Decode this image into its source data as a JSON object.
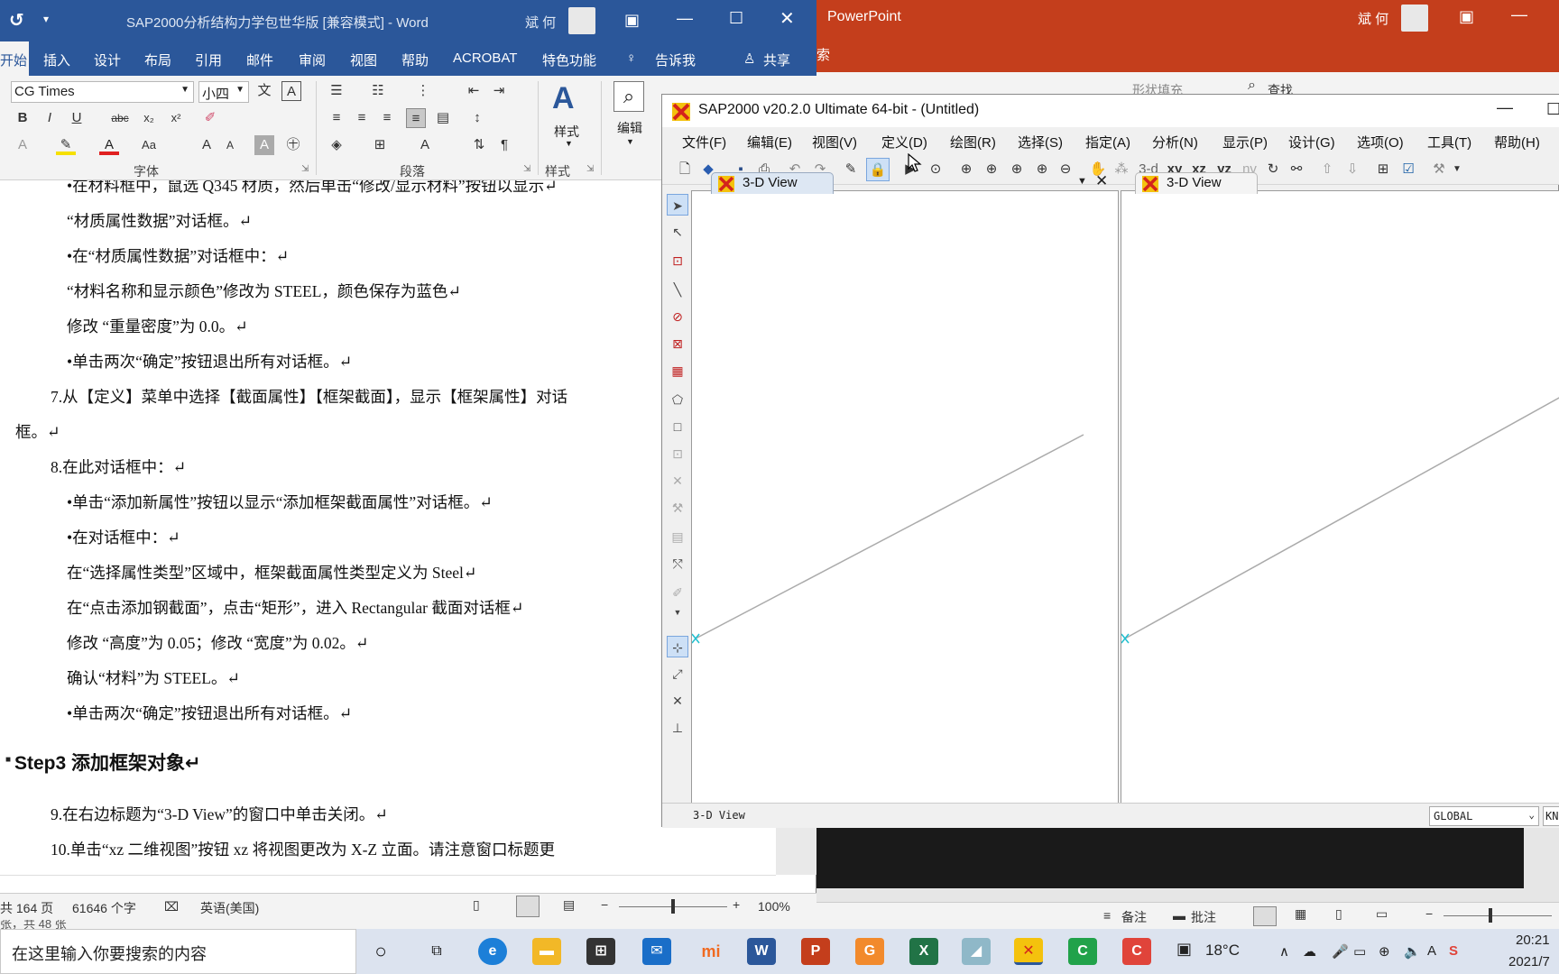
{
  "ppt": {
    "title": "PowerPoint",
    "user": "斌 何",
    "ribbon_tab_partial": "索",
    "ribbon_search": "查找",
    "ribbon_shape_fill": "形状填充",
    "status_notes": "备注",
    "status_comments": "批注"
  },
  "word": {
    "title": "SAP2000分析结构力学包世华版 [兼容模式]  -  Word",
    "user": "斌 何",
    "tabs": [
      "开始",
      "插入",
      "设计",
      "布局",
      "引用",
      "邮件",
      "审阅",
      "视图",
      "帮助",
      "ACROBAT",
      "特色功能"
    ],
    "tell_me": "告诉我",
    "share": "共享",
    "font_name": "CG Times",
    "font_size": "小四",
    "group_font": "字体",
    "group_paragraph": "段落",
    "group_styles": "样式",
    "styles_button": "样式",
    "edit_button": "编辑",
    "doc_lines": [
      "•在材料框中，鼠选 Q345 材质，然后单击“修改/显示材料”按钮以显示↵",
      "“材质属性数据”对话框。↵",
      "•在“材质属性数据”对话框中：↵",
      "“材料名称和显示颜色”修改为 STEEL，颜色保存为蓝色↵",
      "修改  “重量密度”为 0.0。↵",
      "•单击两次“确定”按钮退出所有对话框。↵",
      "7.从【定义】菜单中选择【截面属性】【框架截面】，显示【框架属性】对话",
      "框。↵",
      "8.在此对话框中：↵",
      "•单击“添加新属性”按钮以显示“添加框架截面属性”对话框。↵",
      "•在对话框中：↵",
      "在“选择属性类型”区域中，框架截面属性类型定义为 Steel↵",
      "在“点击添加钢截面”，点击“矩形”，进入 Rectangular 截面对话框↵",
      "修改  “高度”为 0.05；修改  “宽度”为 0.02。↵",
      "确认“材料”为 STEEL。↵",
      "•单击两次“确定”按钮退出所有对话框。↵",
      "Step3  添加框架对象↵",
      "9.在右边标题为“3-D View”的窗口中单击关闭。↵",
      "10.单击“xz 二维视图”按钮 xz 将视图更改为 X-Z 立面。请注意窗口标题更"
    ],
    "status_pages": "共 164 页",
    "status_words": "61646 个字",
    "status_lang": "英语(美国)",
    "status_zoom": "100%",
    "status_page_partial": "张，共 48 张"
  },
  "sap": {
    "title": "SAP2000 v20.2.0 Ultimate 64-bit - (Untitled)",
    "menu": [
      "文件(F)",
      "编辑(E)",
      "视图(V)",
      "定义(D)",
      "绘图(R)",
      "选择(S)",
      "指定(A)",
      "分析(N)",
      "显示(P)",
      "设计(G)",
      "选项(O)",
      "工具(T)",
      "帮助(H)"
    ],
    "toolbar_text": [
      "3-d",
      "xy",
      "xz",
      "yz",
      "nv"
    ],
    "view_tab_left": "3-D View",
    "view_tab_right": "3-D View",
    "status_view": "3-D View",
    "coord_system": "GLOBAL",
    "units_partial": "KN"
  },
  "taskbar": {
    "search_placeholder": "在这里输入你要搜索的内容",
    "weather": "18°C",
    "time": "20:21",
    "date": "2021/7"
  }
}
